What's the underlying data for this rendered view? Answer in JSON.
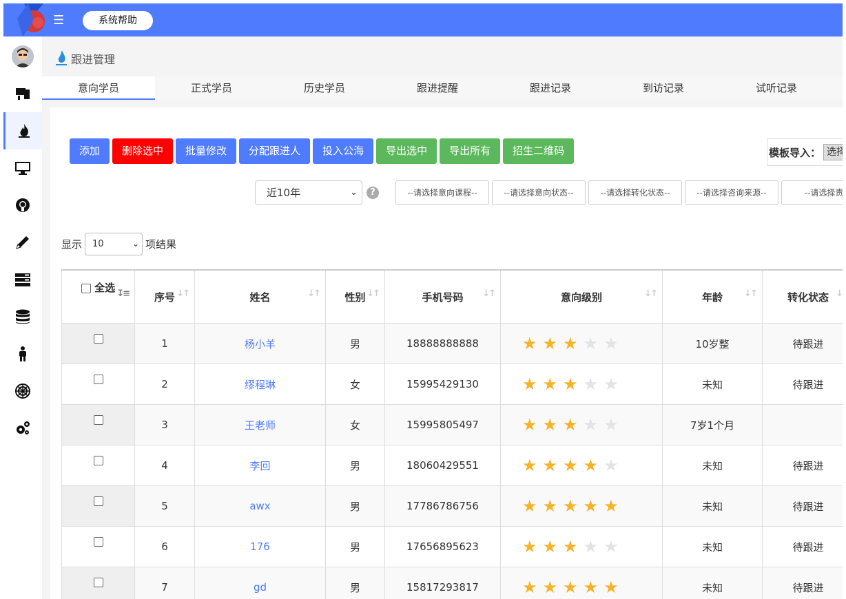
{
  "header": {
    "help_label": "系统帮助"
  },
  "page": {
    "title": "跟进管理"
  },
  "tabs": [
    {
      "label": "意向学员"
    },
    {
      "label": "正式学员"
    },
    {
      "label": "历史学员"
    },
    {
      "label": "跟进提醒"
    },
    {
      "label": "跟进记录"
    },
    {
      "label": "到访记录"
    },
    {
      "label": "试听记录"
    }
  ],
  "toolbar": {
    "add": "添加",
    "delete_selected": "删除选中",
    "batch_edit": "批量修改",
    "assign_follower": "分配跟进人",
    "to_public_pool": "投入公海",
    "export_selected": "导出选中",
    "export_all": "导出所有",
    "enroll_qrcode": "招生二维码",
    "import_label": "模板导入：",
    "import_button": "选择"
  },
  "filters": {
    "year": "近10年",
    "help": "?",
    "course": "--请选择意向课程--",
    "intent_status": "--请选择意向状态--",
    "conversion_status": "--请选择转化状态--",
    "source": "--请选择咨询来源--",
    "responsible": "--请选择责任"
  },
  "length": {
    "prefix": "显示",
    "value": "10",
    "suffix": "项结果"
  },
  "table": {
    "select_all": "全选",
    "headers": {
      "index": "序号",
      "name": "姓名",
      "gender": "性别",
      "phone": "手机号码",
      "intent_level": "意向级别",
      "age": "年龄",
      "conversion": "转化状态"
    },
    "rows": [
      {
        "index": "1",
        "name": "杨小羊",
        "gender": "男",
        "phone": "18888888888",
        "stars": 3,
        "age": "10岁整",
        "conversion": "待跟进"
      },
      {
        "index": "2",
        "name": "缪程琳",
        "gender": "女",
        "phone": "15995429130",
        "stars": 3,
        "age": "未知",
        "conversion": "待跟进"
      },
      {
        "index": "3",
        "name": "王老师",
        "gender": "女",
        "phone": "15995805497",
        "stars": 3,
        "age": "7岁1个月",
        "conversion": ""
      },
      {
        "index": "4",
        "name": "李回",
        "gender": "男",
        "phone": "18060429551",
        "stars": 4,
        "age": "未知",
        "conversion": "待跟进"
      },
      {
        "index": "5",
        "name": "awx",
        "gender": "男",
        "phone": "17786786756",
        "stars": 5,
        "age": "未知",
        "conversion": "待跟进"
      },
      {
        "index": "6",
        "name": "176",
        "gender": "男",
        "phone": "17656895623",
        "stars": 3,
        "age": "未知",
        "conversion": "待跟进"
      },
      {
        "index": "7",
        "name": "gd",
        "gender": "男",
        "phone": "15817293817",
        "stars": 5,
        "age": "未知",
        "conversion": "待跟进"
      }
    ]
  },
  "colors": {
    "primary": "#4f7bff",
    "danger": "#ff0000",
    "success": "#5cb85c",
    "star": "#f5b325"
  }
}
